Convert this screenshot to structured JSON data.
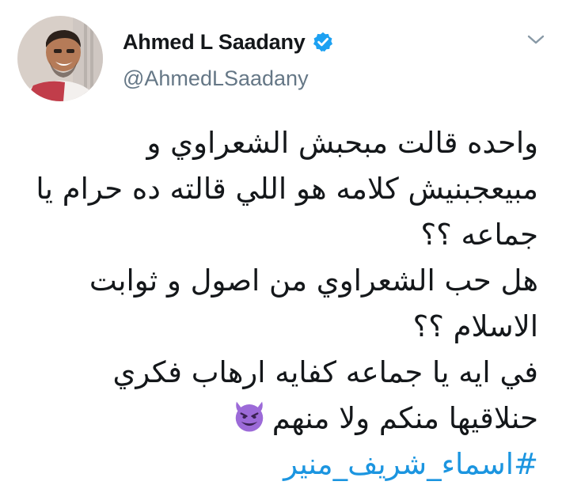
{
  "author": {
    "display_name": "Ahmed L Saadany",
    "handle": "@AhmedLSaadany",
    "verified": true
  },
  "icons": {
    "verified": "verified-badge-icon",
    "menu": "chevron-down-icon",
    "emoji": "smiling-face-with-horns-emoji"
  },
  "tweet": {
    "lines": [
      "واحده قالت مبحبش الشعراوي و",
      "مبيعجبنيش كلامه هو اللي قالته ده حرام يا",
      "جماعه ؟؟",
      "هل حب الشعراوي من اصول و ثوابت",
      "الاسلام ؟؟",
      "في ايه يا جماعه كفايه ارهاب فكري",
      "حنلاقيها منكم ولا منهم"
    ],
    "hashtag": "#اسماء_شريف_منير"
  },
  "colors": {
    "text": "#14171a",
    "secondary": "#657786",
    "link": "#1b95e0",
    "verified": "#1da1f2",
    "emoji": "#9c6ad8"
  }
}
